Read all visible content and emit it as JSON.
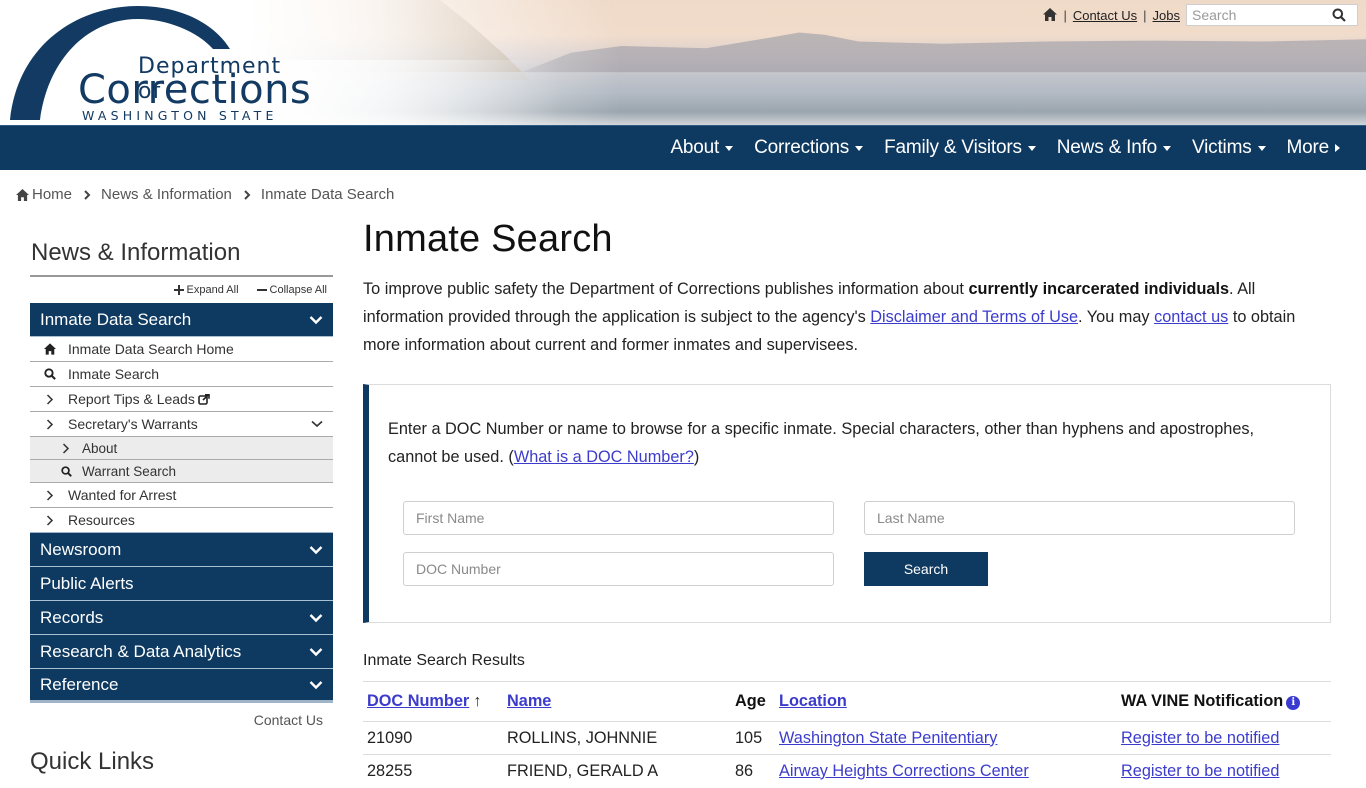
{
  "header": {
    "logo": {
      "line1": "Department of",
      "line2": "Corrections",
      "line3": "WASHINGTON STATE"
    },
    "utility": {
      "home_icon": "home-icon",
      "separator": "|",
      "contact_label": "Contact Us",
      "jobs_label": "Jobs",
      "search_placeholder": "Search",
      "search_value": ""
    },
    "colors": {
      "navy": "#0e3a61",
      "link": "#3c3ccc"
    }
  },
  "nav": {
    "items": [
      {
        "label": "About",
        "indicator": "caret-down"
      },
      {
        "label": "Corrections",
        "indicator": "caret-down"
      },
      {
        "label": "Family & Visitors",
        "indicator": "caret-down"
      },
      {
        "label": "News & Info",
        "indicator": "caret-down"
      },
      {
        "label": "Victims",
        "indicator": "caret-down"
      },
      {
        "label": "More",
        "indicator": "caret-right"
      }
    ]
  },
  "breadcrumb": {
    "items": [
      "Home",
      "News & Information",
      "Inmate Data Search"
    ]
  },
  "sidebar": {
    "title": "News & Information",
    "expand_all": "Expand All",
    "collapse_all": "Collapse All",
    "active_section": {
      "label": "Inmate Data Search",
      "children": [
        {
          "label": "Inmate Data Search Home",
          "icon": "home-icon"
        },
        {
          "label": "Inmate Search",
          "icon": "search-icon"
        },
        {
          "label": "Report Tips & Leads",
          "icon": "chevron-right-icon",
          "trailing_icon": "external-link-icon"
        },
        {
          "label": "Secretary's Warrants",
          "icon": "chevron-right-icon",
          "trailing_icon": "chevron-down-icon",
          "children": [
            {
              "label": "About",
              "icon": "chevron-right-icon"
            },
            {
              "label": "Warrant Search",
              "icon": "search-icon"
            }
          ]
        },
        {
          "label": "Wanted for Arrest",
          "icon": "chevron-right-icon"
        },
        {
          "label": "Resources",
          "icon": "chevron-right-icon"
        }
      ]
    },
    "sections": [
      {
        "label": "Newsroom",
        "expandable": true
      },
      {
        "label": "Public Alerts",
        "expandable": false
      },
      {
        "label": "Records",
        "expandable": true
      },
      {
        "label": "Research & Data Analytics",
        "expandable": true
      },
      {
        "label": "Reference",
        "expandable": true
      }
    ],
    "contact_label": "Contact Us",
    "quick_links_title": "Quick Links"
  },
  "main": {
    "title": "Inmate Search",
    "intro": {
      "part1": "To improve public safety the Department of Corrections publishes information about ",
      "bold": "currently incarcerated individuals",
      "part2": ". All information provided through the application is subject to the agency's ",
      "link1": "Disclaimer and Terms of Use",
      "part3": ". You may ",
      "link2": "contact us",
      "part4": " to obtain more information about current and former inmates and supervisees."
    },
    "search_form": {
      "help_text": "Enter a DOC Number or name to browse for a specific inmate. Special characters, other than hyphens and apostrophes, cannot be used. (",
      "help_link": "What is a DOC Number?",
      "help_close": ")",
      "first_name_placeholder": "First Name",
      "last_name_placeholder": "Last Name",
      "doc_number_placeholder": "DOC Number",
      "first_name_value": "",
      "last_name_value": "",
      "doc_number_value": "",
      "search_button": "Search"
    },
    "results": {
      "title": "Inmate Search Results",
      "columns": [
        {
          "label": "DOC Number",
          "sortable": true,
          "sort": "↑"
        },
        {
          "label": "Name",
          "sortable": true
        },
        {
          "label": "Age",
          "sortable": false
        },
        {
          "label": "Location",
          "sortable": true
        },
        {
          "label": "WA VINE Notification",
          "sortable": false,
          "icon": "info-icon"
        }
      ],
      "rows": [
        {
          "doc_number": "21090",
          "name": "ROLLINS, JOHNNIE",
          "age": "105",
          "location": "Washington State Penitentiary",
          "vine": "Register to be notified"
        },
        {
          "doc_number": "28255",
          "name": "FRIEND, GERALD A",
          "age": "86",
          "location": "Airway Heights Corrections Center",
          "vine": "Register to be notified"
        }
      ]
    }
  }
}
